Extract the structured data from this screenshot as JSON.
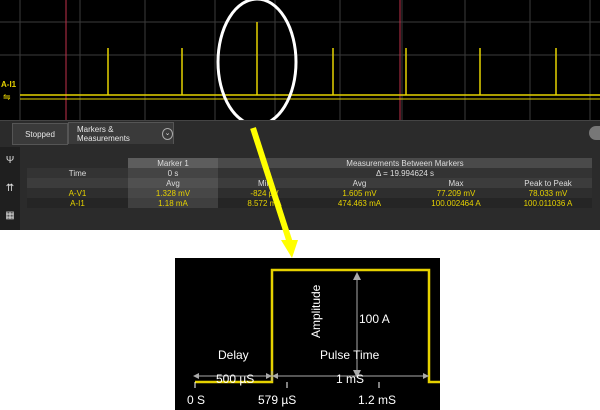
{
  "scope": {
    "channel_labels": [
      "A-I1",
      "A-V1"
    ]
  },
  "status_bar": {
    "stopped_label": "Stopped",
    "tab_label": "Markers & Measurements",
    "tab_chevron": "⌄"
  },
  "table": {
    "marker1_header": "Marker 1",
    "between_header": "Measurements Between Markers",
    "time_label": "Time",
    "time_marker1": "0 s",
    "delta": "Δ = 19.994624 s",
    "columns": [
      "Avg",
      "Min",
      "Avg",
      "Max",
      "Peak to Peak"
    ],
    "rows": [
      {
        "name": "A-V1",
        "marker1": "1.328 mV",
        "min": "-824 μV",
        "avg": "1.605 mV",
        "max": "77.209 mV",
        "p2p": "78.033 mV"
      },
      {
        "name": "A-I1",
        "marker1": "1.18 mA",
        "min": "8.572 mA",
        "avg": "474.463 mA",
        "max": "100.002464 A",
        "p2p": "100.011036 A"
      }
    ]
  },
  "pulse": {
    "amplitude_label": "Amplitude",
    "amplitude_value": "100 A",
    "delay_label": "Delay",
    "pulse_time_label": "Pulse Time",
    "delay_value": "500 µS",
    "pulse_value": "1 mS",
    "tick_labels": [
      "0 S",
      "579 µS",
      "1.2 mS"
    ]
  },
  "colors": {
    "trace": "#e6d200",
    "marker_line": "#c0304a",
    "arrow": "#ffff00"
  }
}
